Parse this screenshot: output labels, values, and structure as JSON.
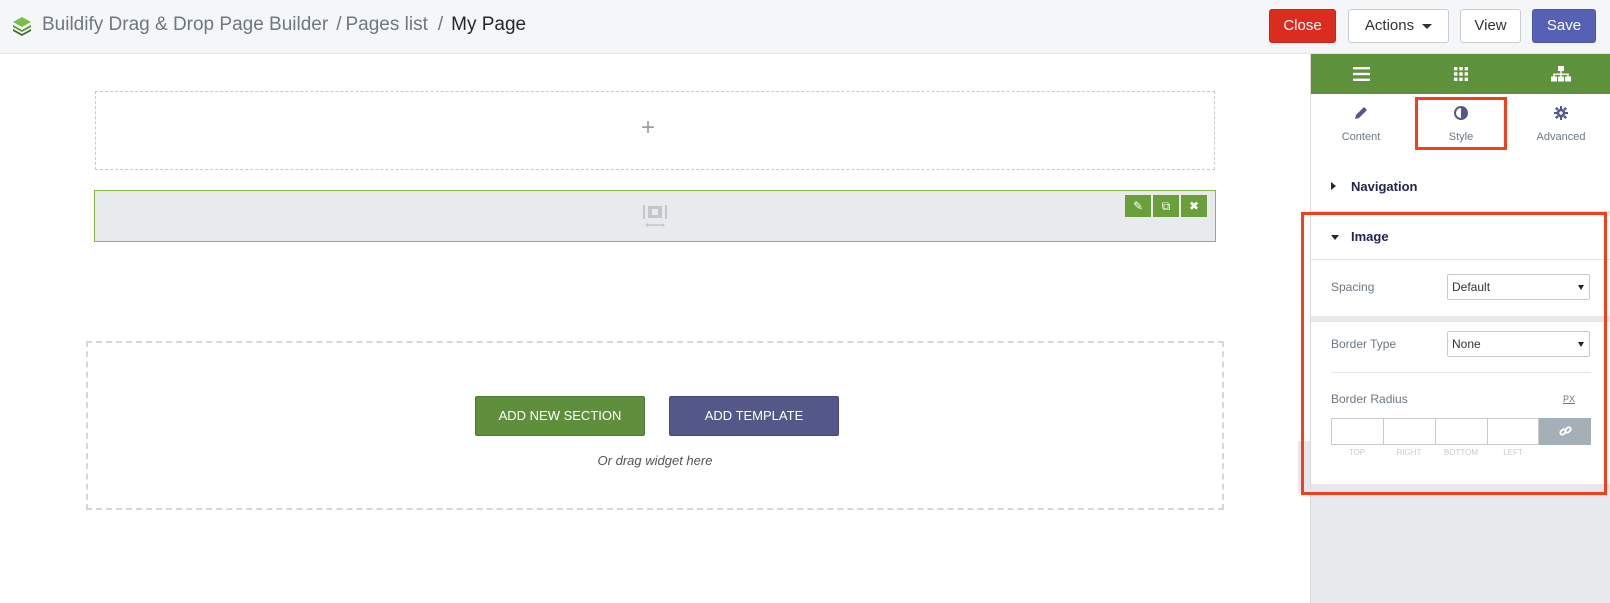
{
  "header": {
    "app_title": "Buildify Drag & Drop Page Builder",
    "crumb_pages": "Pages list",
    "crumb_current": "My Page",
    "sep": "/",
    "close_label": "Close",
    "actions_label": "Actions",
    "view_label": "View",
    "save_label": "Save"
  },
  "canvas": {
    "add_new_section": "ADD NEW SECTION",
    "add_template": "ADD TEMPLATE",
    "drag_hint": "Or drag widget here"
  },
  "panel": {
    "tabs": [
      {
        "label": "Content",
        "icon": "pencil-icon"
      },
      {
        "label": "Style",
        "icon": "contrast-icon"
      },
      {
        "label": "Advanced",
        "icon": "gear-icon"
      }
    ],
    "navigation_title": "Navigation",
    "image_title": "Image",
    "spacing_label": "Spacing",
    "spacing_value": "Default",
    "border_type_label": "Border Type",
    "border_type_value": "None",
    "border_radius_label": "Border Radius",
    "unit": "PX",
    "dim_labels": [
      "TOP",
      "RIGHT",
      "BOTTOM",
      "LEFT"
    ]
  },
  "colors": {
    "accent_green": "#5e913b",
    "save_blue": "#5661b5",
    "close_red": "#dc2b1f",
    "highlight": "#f2401d"
  }
}
